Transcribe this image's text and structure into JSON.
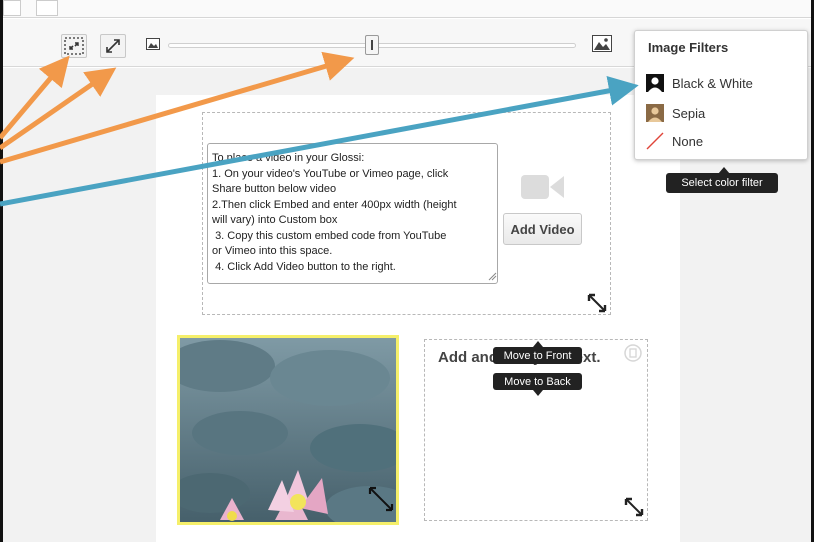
{
  "toolbar": {
    "tool1_icon": "crop-fit-icon",
    "tool2_icon": "expand-icon",
    "zoom_out_icon": "small-image-icon",
    "zoom_in_icon": "large-image-icon"
  },
  "slider": {
    "value": 0.5
  },
  "filters_menu": {
    "title": "Image Filters",
    "items": [
      {
        "label": "Black & White",
        "icon": "person-bw-icon"
      },
      {
        "label": "Sepia",
        "icon": "person-sepia-icon"
      },
      {
        "label": "None",
        "icon": "no-filter-icon"
      }
    ],
    "tooltip": "Select color filter"
  },
  "video_block": {
    "instructions": "To place a video in your Glossi:\n1. On your video's YouTube or Vimeo page, click\nShare button below video\n2.Then click Embed and enter 400px width (height\nwill vary) into Custom box\n 3. Copy this custom embed code from YouTube\nor Vimeo into this space.\n 4. Click Add Video button to the right.",
    "add_button": "Add Video",
    "icon": "video-camera-icon"
  },
  "text_block": {
    "content": "Add and edit your text.",
    "tooltip_front": "Move to Front",
    "tooltip_back": "Move to Back"
  },
  "colors": {
    "arrow_orange": "#f2994a",
    "arrow_blue": "#4aa3c2",
    "image_highlight": "#f5ef6a",
    "tooltip_bg": "#222222"
  }
}
